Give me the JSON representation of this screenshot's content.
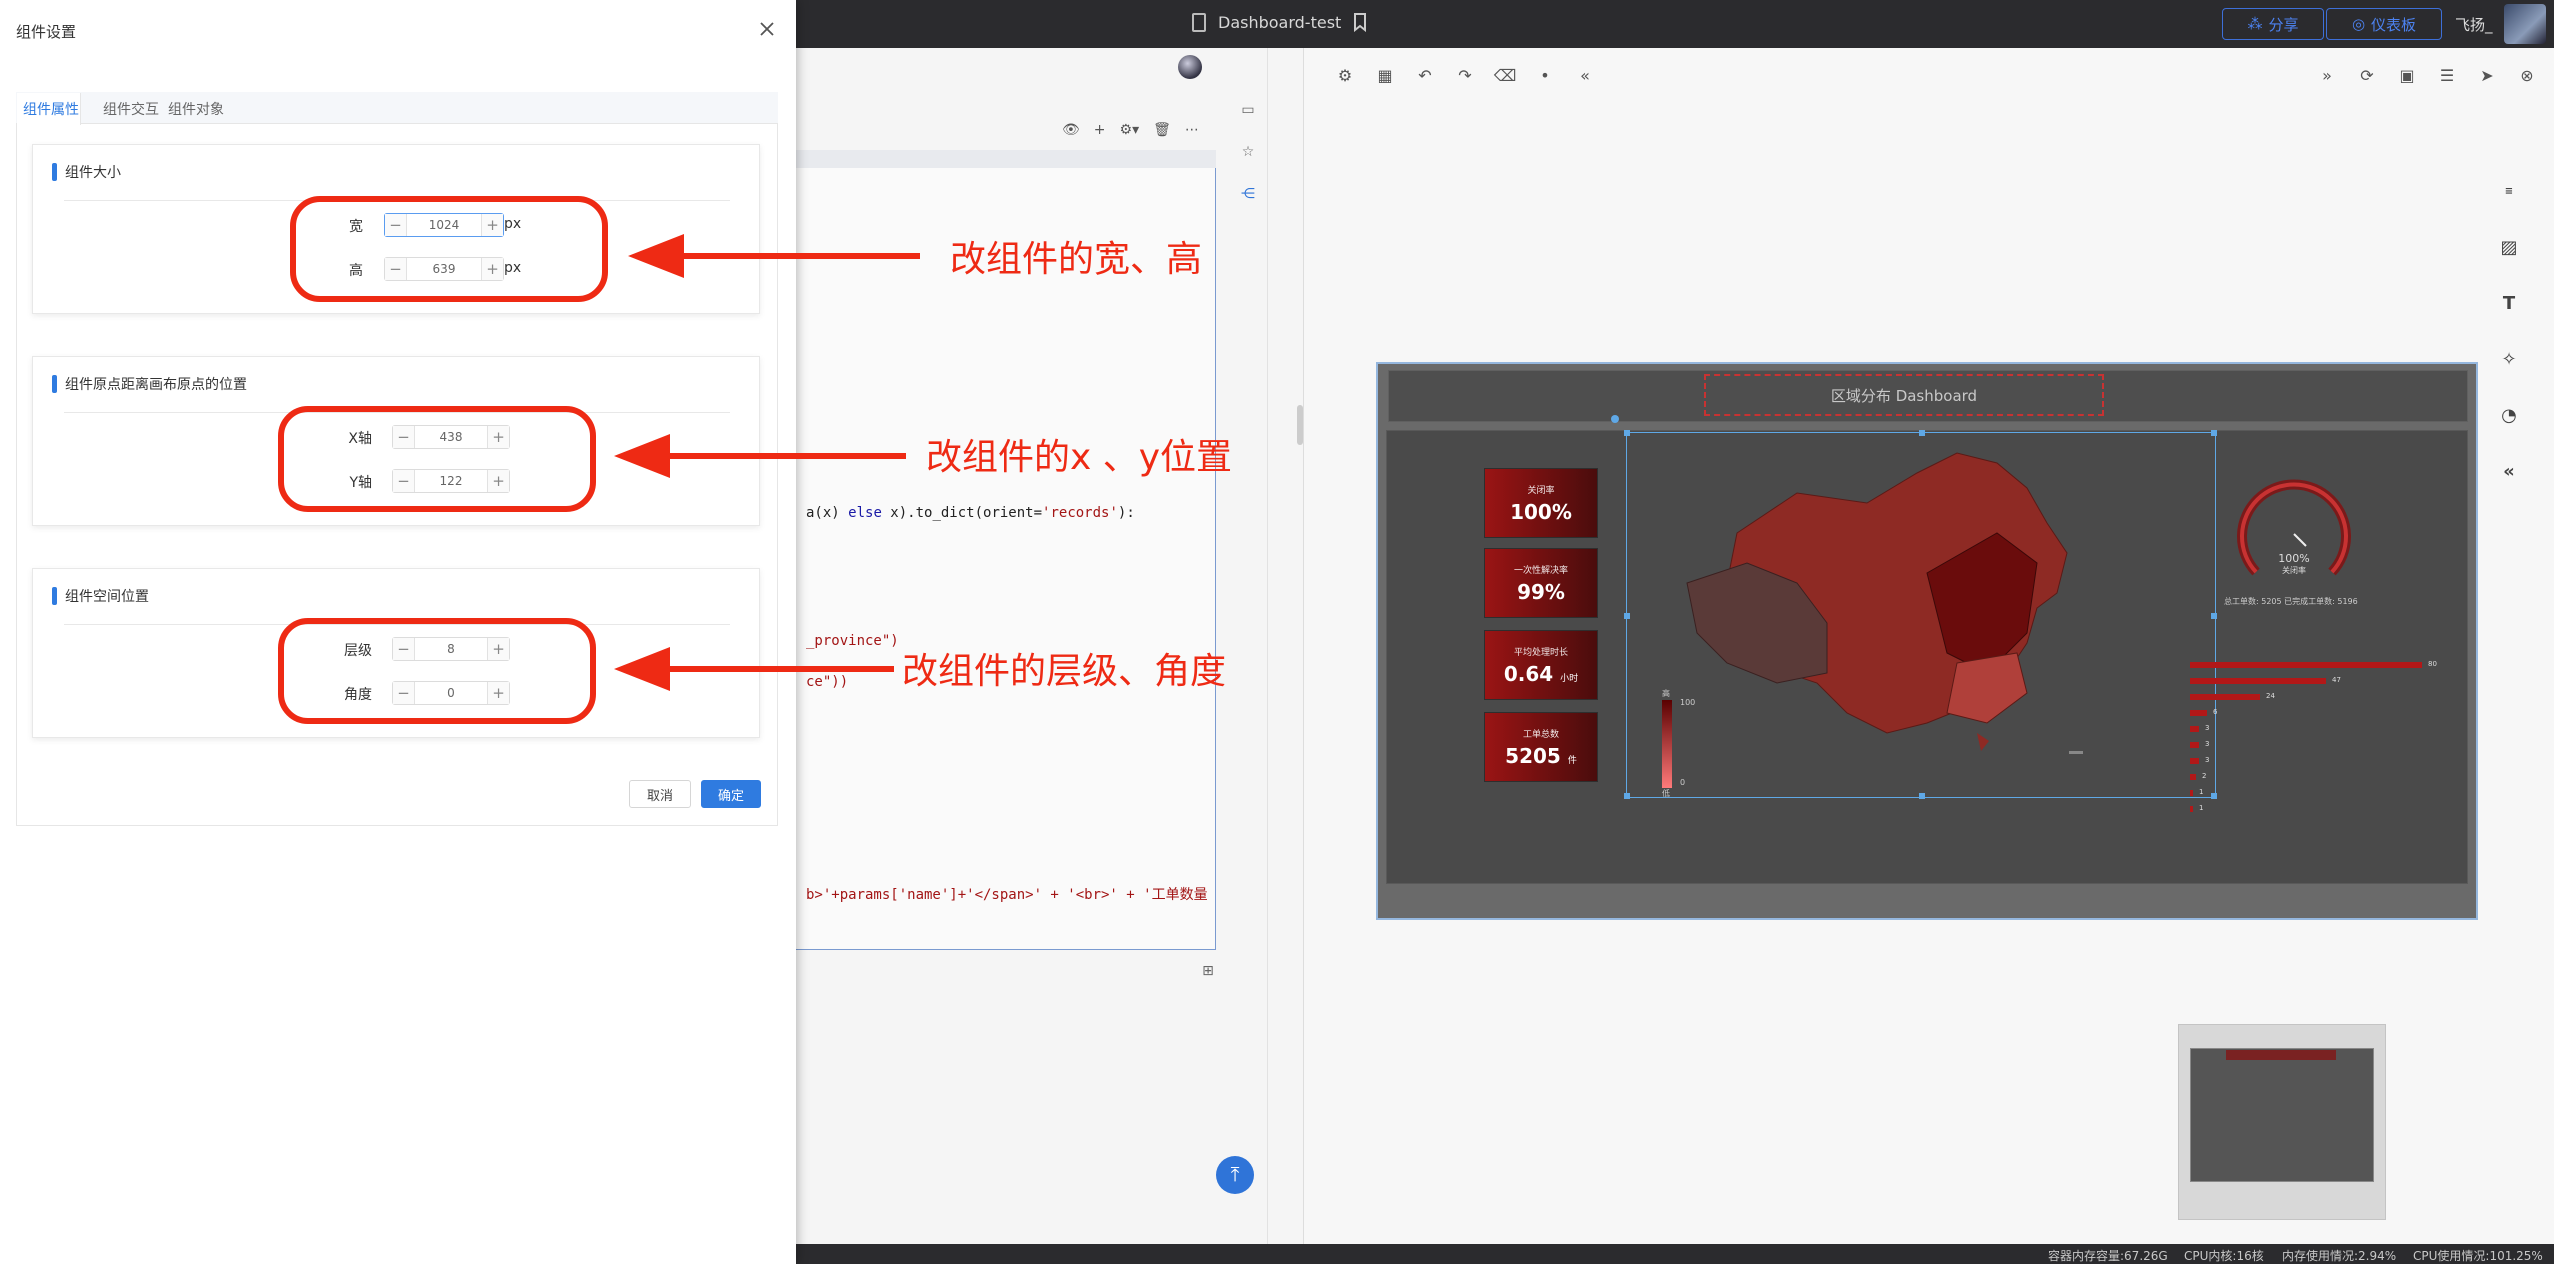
{
  "topbar": {
    "doc_title": "Dashboard-test",
    "share_label": "分享",
    "dashboard_label": "仪表板",
    "user_name": "飞扬_"
  },
  "editor": {
    "code_lines": [
      {
        "pre": "",
        "a": "a(x) ",
        "kw": "else",
        "b": " x).to_dict(orient=",
        "str": "'records'",
        "c": "):"
      },
      {
        "pre": "",
        "a": "",
        "kw": "",
        "b": "",
        "str": "_province\")",
        "c": ""
      },
      {
        "pre": "",
        "a": "",
        "kw": "",
        "b": "",
        "str": "ce\"))",
        "c": ""
      },
      {
        "pre": "",
        "a": "",
        "kw": "",
        "b": "",
        "str": "b>'+params['name']+'</span>' + '<br>' + '工单数量",
        "c": ""
      }
    ]
  },
  "dashboard": {
    "title": "区域分布 Dashboard",
    "kpis": [
      {
        "label": "关闭率",
        "value": "100%",
        "unit": ""
      },
      {
        "label": "一次性解决率",
        "value": "99%",
        "unit": ""
      },
      {
        "label": "平均处理时长",
        "value": "0.64",
        "unit": "小时"
      },
      {
        "label": "工单总数",
        "value": "5205",
        "unit": "件"
      }
    ],
    "gauge_value": "100%",
    "gauge_label": "关闭率",
    "gauge_sub": "总工单数: 5205 已完成工单数: 5196",
    "legend_top": "高",
    "legend_max": "100",
    "legend_min": "0",
    "legend_bottom": "低",
    "bars": [
      {
        "value": 80
      },
      {
        "value": 47
      },
      {
        "value": 24
      },
      {
        "value": 6
      },
      {
        "value": 3
      },
      {
        "value": 3
      },
      {
        "value": 3
      },
      {
        "value": 2
      },
      {
        "value": 1
      },
      {
        "value": 1
      }
    ],
    "bar_max": 80
  },
  "status": {
    "container_mem": "容器内存容量:67.26G",
    "cpu_cores": "CPU内核:16核",
    "mem_usage": "内存使用情况:2.94%",
    "cpu_usage": "CPU使用情况:101.25%"
  },
  "drawer": {
    "title": "组件设置",
    "tabs": [
      "组件属性",
      "组件交互",
      "组件对象"
    ],
    "size_section": {
      "title": "组件大小",
      "width_label": "宽",
      "width_value": "1024",
      "height_label": "高",
      "height_value": "639",
      "unit": "px"
    },
    "position_section": {
      "title": "组件原点距离画布原点的位置",
      "x_label": "X轴",
      "x_value": "438",
      "y_label": "Y轴",
      "y_value": "122"
    },
    "space_section": {
      "title": "组件空间位置",
      "layer_label": "层级",
      "layer_value": "8",
      "angle_label": "角度",
      "angle_value": "0"
    },
    "cancel_label": "取消",
    "ok_label": "确定"
  },
  "annotations": {
    "size_note": "改组件的宽、高",
    "position_note": "改组件的x 、y位置",
    "space_note": "改组件的层级、角度",
    "color": "#ee2a14"
  }
}
